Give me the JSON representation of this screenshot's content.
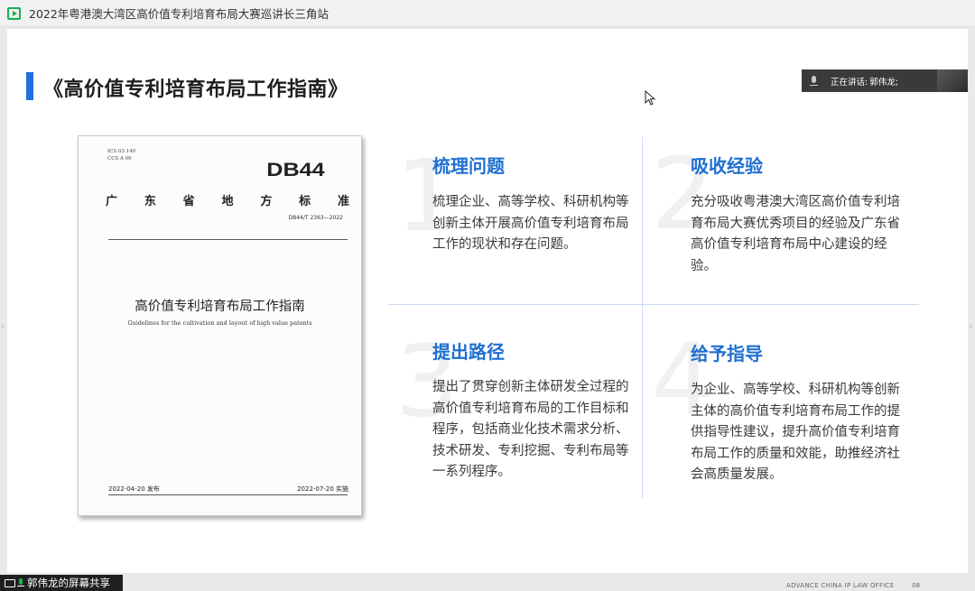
{
  "window": {
    "title": "2022年粤港澳大湾区高价值专利培育布局大赛巡讲长三角站",
    "app_icon": "play-icon"
  },
  "slide": {
    "title": "《高价值专利培育布局工作指南》",
    "accent_color": "#1e6fe0",
    "footer_org": "ADVANCE CHINA IP LAW OFFICE",
    "footer_page": "08"
  },
  "speaker": {
    "speaking_label": "正在讲话:",
    "name": "郭伟龙;"
  },
  "document": {
    "ics_line1": "ICS 03.140",
    "ics_line2": "CCS A 00",
    "code": "DB44",
    "type_chars": [
      "广",
      "东",
      "省",
      "地",
      "方",
      "标",
      "准"
    ],
    "number": "DB44/T 2363—2022",
    "title": "高价值专利培育布局工作指南",
    "subtitle": "Guidelines for the cultivation and layout of high value patents",
    "issue_date": "2022-04-20 发布",
    "implement_date": "2022-07-20 实施"
  },
  "panels": [
    {
      "number": "1",
      "title": "梳理问题",
      "text": "梳理企业、高等学校、科研机构等创新主体开展高价值专利培育布局工作的现状和存在问题。"
    },
    {
      "number": "2",
      "title": "吸收经验",
      "text": "充分吸收粤港澳大湾区高价值专利培育布局大赛优秀项目的经验及广东省高价值专利培育布局中心建设的经验。"
    },
    {
      "number": "3",
      "title": "提出路径",
      "text": "提出了贯穿创新主体研发全过程的高价值专利培育布局的工作目标和程序，包括商业化技术需求分析、技术研发、专利挖掘、专利布局等一系列程序。"
    },
    {
      "number": "4",
      "title": "给予指导",
      "text": "为企业、高等学校、科研机构等创新主体的高价值专利培育布局工作的提供指导性建议，提升高价值专利培育布局工作的质量和效能，助推经济社会高质量发展。"
    }
  ],
  "share_tag": {
    "text": "郭伟龙的屏幕共享"
  },
  "colors": {
    "panel_title": "#1f6fd1",
    "divider": "#c8d8f1"
  }
}
